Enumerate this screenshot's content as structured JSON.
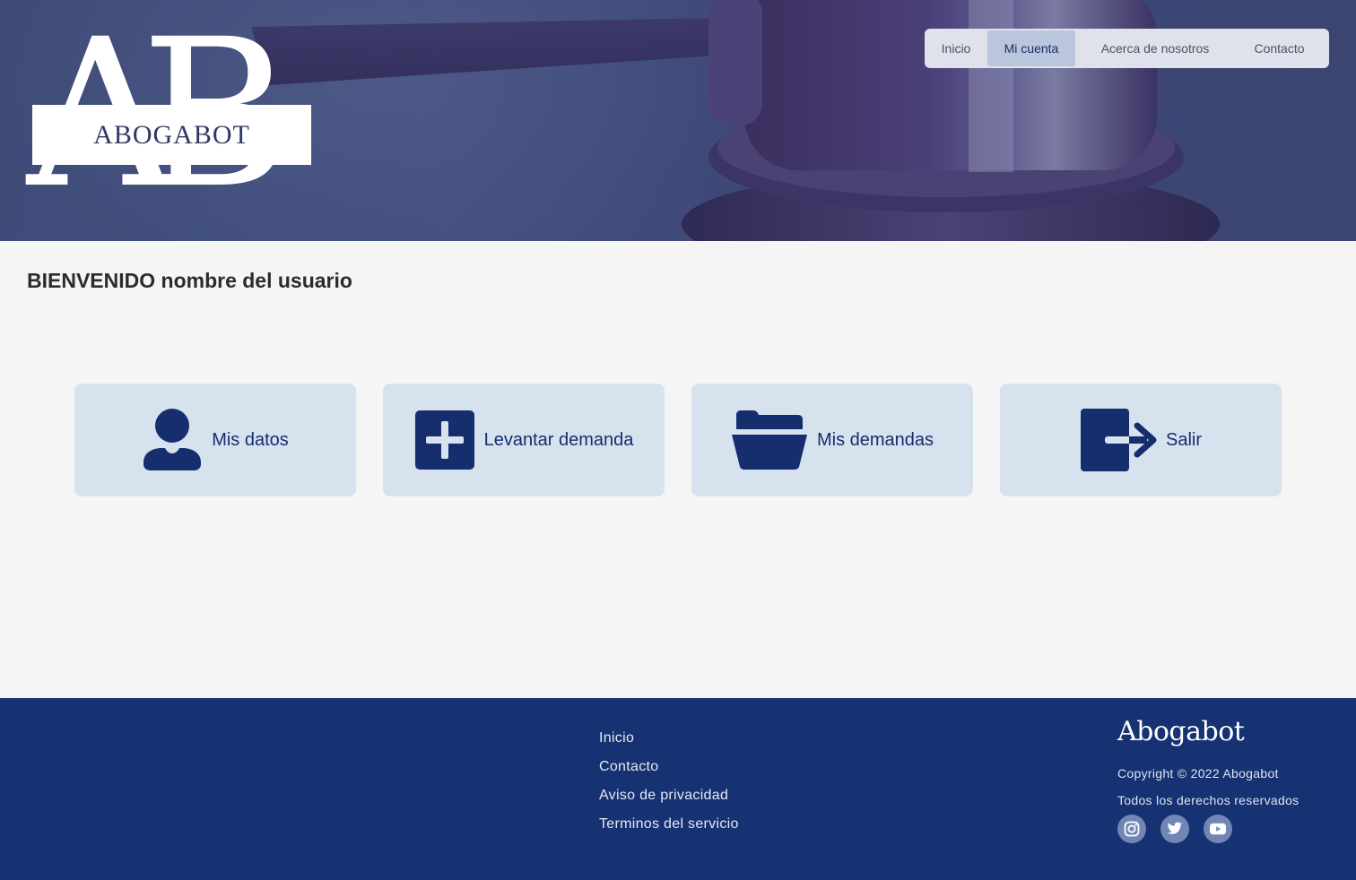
{
  "header": {
    "logo_letters": "AB",
    "logo_word": "ABOGABOT",
    "nav": [
      {
        "label": "Inicio",
        "active": false
      },
      {
        "label": "Mi cuenta",
        "active": true
      },
      {
        "label": "Acerca de nosotros",
        "active": false
      },
      {
        "label": "Contacto",
        "active": false
      }
    ]
  },
  "main": {
    "welcome": "BIENVENIDO nombre del usuario",
    "cards": [
      {
        "label": "Mis datos",
        "icon": "user-icon"
      },
      {
        "label": "Levantar demanda",
        "icon": "plus-square-icon"
      },
      {
        "label": "Mis demandas",
        "icon": "folder-open-icon"
      },
      {
        "label": "Salir",
        "icon": "sign-out-icon"
      }
    ]
  },
  "footer": {
    "links": [
      "Inicio",
      "Contacto",
      "Aviso de privacidad",
      "Terminos del servicio"
    ],
    "brand": "Abogabot",
    "copyright": "Copyright © 2022 Abogabot",
    "rights": "Todos los derechos reservados",
    "socials": [
      "instagram-icon",
      "twitter-icon",
      "youtube-icon"
    ]
  },
  "colors": {
    "primary": "#163272",
    "card_bg": "#d6e3ef",
    "nav_active_bg": "#b9c6dc",
    "page_bg": "#f5f5f5"
  }
}
